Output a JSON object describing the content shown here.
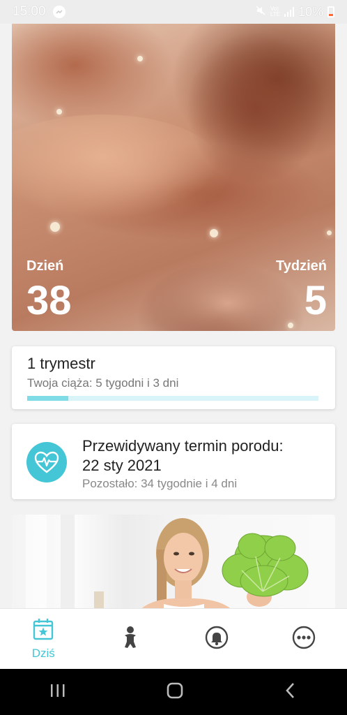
{
  "status_bar": {
    "time": "15:00",
    "battery": "10%",
    "network": "Vo) LTE+ LTE1"
  },
  "hero": {
    "day_label": "Dzień",
    "day_value": "38",
    "week_label": "Tydzień",
    "week_value": "5"
  },
  "trimester": {
    "title": "1 trymestr",
    "subtitle": "Twoja ciąża: 5 tygodni i 3 dni",
    "progress": 0.14
  },
  "due_date": {
    "icon": "heart-pulse-icon",
    "title_line1": "Przewidywany termin porodu:",
    "title_line2": "22 sty 2021",
    "remaining": "Pozostało: 34 tygodnie i 4 dni"
  },
  "bottom_nav": {
    "items": [
      {
        "label": "Dziś",
        "icon": "calendar-star-icon",
        "active": true
      },
      {
        "label": "",
        "icon": "baby-icon",
        "active": false
      },
      {
        "label": "",
        "icon": "bell-icon",
        "active": false
      },
      {
        "label": "",
        "icon": "more-icon",
        "active": false
      }
    ]
  },
  "colors": {
    "accent": "#45c6d6",
    "progress_track": "#d9f4f8",
    "progress_fill": "#7fdbe6"
  }
}
